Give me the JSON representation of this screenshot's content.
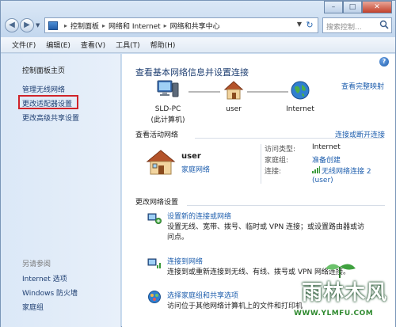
{
  "window": {
    "controls": {
      "minimize": "–",
      "maximize": "□",
      "close": "✕"
    }
  },
  "nav": {
    "back": "◀",
    "forward": "▶"
  },
  "address": {
    "crumbs": [
      "控制面板",
      "网络和 Internet",
      "网络和共享中心"
    ]
  },
  "search": {
    "placeholder": "搜索控制..."
  },
  "menu": [
    "文件(F)",
    "编辑(E)",
    "查看(V)",
    "工具(T)",
    "帮助(H)"
  ],
  "sidebar": {
    "home": "控制面板主页",
    "items": [
      "管理无线网络",
      "更改适配器设置",
      "更改高级共享设置"
    ],
    "see_also_label": "另请参阅",
    "see_also": [
      "Internet 选项",
      "Windows 防火墙",
      "家庭组"
    ]
  },
  "main": {
    "heading": "查看基本网络信息并设置连接",
    "full_map": "查看完整映射",
    "map": {
      "pc_name": "SLD-PC",
      "pc_sub": "(此计算机)",
      "network": "user",
      "internet": "Internet"
    },
    "active_section": "查看活动网络",
    "connect_link": "连接或断开连接",
    "active_network": {
      "name": "user",
      "type": "家庭网络",
      "props": [
        {
          "label": "访问类型:",
          "value": "Internet"
        },
        {
          "label": "家庭组:",
          "value": "准备创建"
        },
        {
          "label": "连接:",
          "value": "无线网络连接 2"
        }
      ],
      "conn_sub": "(user)"
    },
    "change_section": "更改网络设置",
    "tasks": [
      {
        "title": "设置新的连接或网络",
        "desc": "设置无线、宽带、拨号、临时或 VPN 连接；或设置路由器或访问点。"
      },
      {
        "title": "连接到网络",
        "desc": "连接到或重新连接到无线、有线、拨号或 VPN 网络连接。"
      },
      {
        "title": "选择家庭组和共享选项",
        "desc": "访问位于其他网络计算机上的文件和打印机"
      }
    ]
  },
  "watermark": {
    "text": "雨林木风",
    "url": "WWW.YLMFU.COM"
  },
  "colors": {
    "link": "#1f5fae",
    "highlight": "#d0232a",
    "sidebar": "#dbe8f7"
  }
}
